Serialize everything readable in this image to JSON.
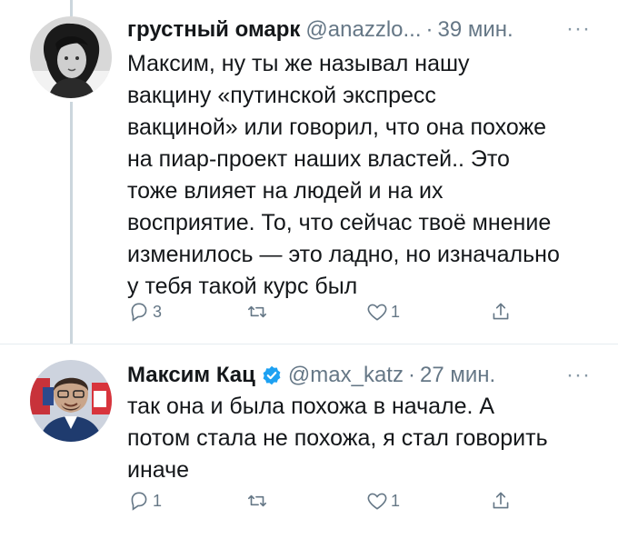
{
  "tweets": [
    {
      "author_name": "грустный омарк",
      "handle": "@anazzlo...",
      "separator": "·",
      "time": "39 мин.",
      "more": "···",
      "text": "Максим, ну ты же называл нашу\nвакцину «путинской экспресс\nвакциной» или говорил, что она похоже\nна пиар-проект наших властей.. Это\nтоже влияет на людей и на их\nвосприятие. То, что сейчас твоё мнение\nизменилось — это ладно, но изначально\nу тебя такой курс был",
      "replies": "3",
      "retweets": "",
      "likes": "1",
      "verified": false
    },
    {
      "author_name": "Максим Кац",
      "handle": "@max_katz",
      "separator": "·",
      "time": "27 мин.",
      "more": "···",
      "text": "так она и была похожа в начале. А\nпотом стала не похожа, я стал говорить\nиначе",
      "replies": "1",
      "retweets": "",
      "likes": "1",
      "verified": true
    }
  ],
  "colors": {
    "text": "#14171a",
    "secondary": "#657786",
    "verified": "#1da1f2",
    "thread_line": "#ccd6dd"
  },
  "icons": [
    "reply-icon",
    "retweet-icon",
    "like-icon",
    "share-icon",
    "verified-icon",
    "more-icon"
  ]
}
